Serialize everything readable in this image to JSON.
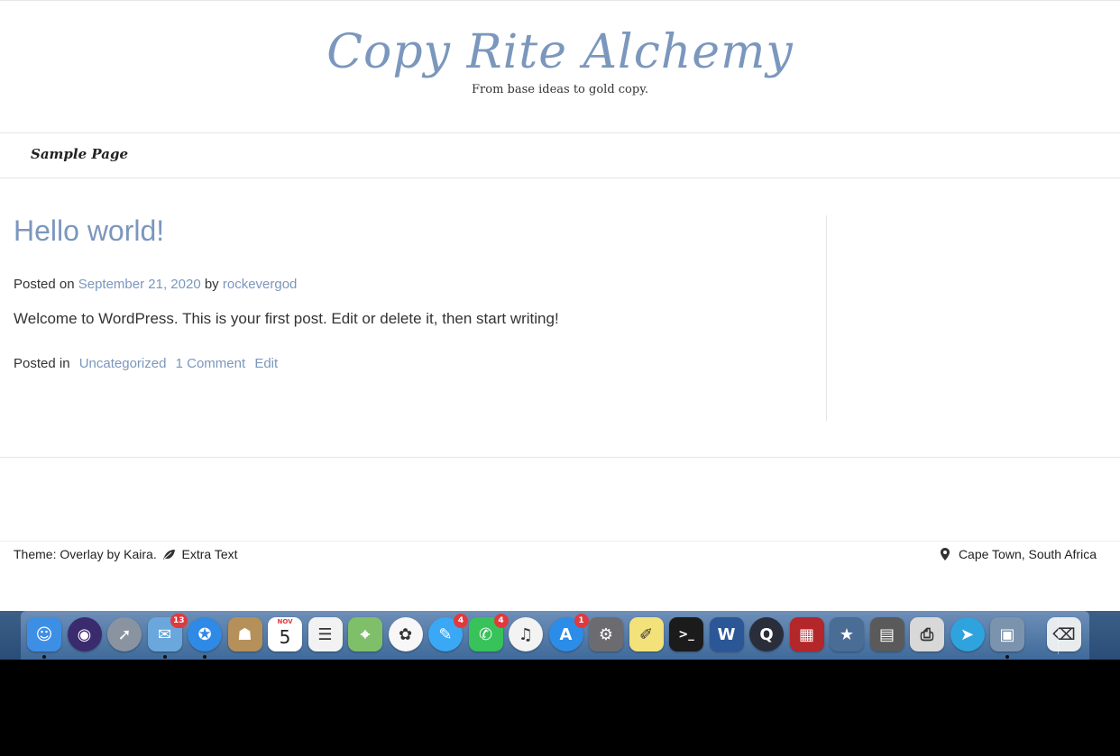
{
  "site": {
    "title": "Copy Rite Alchemy",
    "tagline": "From base ideas to gold copy."
  },
  "nav": {
    "items": [
      {
        "label": "Sample Page"
      }
    ]
  },
  "post": {
    "title": "Hello world!",
    "posted_on_prefix": "Posted on",
    "date": "September 21, 2020",
    "by_text": "by",
    "author": "rockevergod",
    "content": "Welcome to WordPress. This is your first post. Edit or delete it, then start writing!",
    "posted_in_prefix": "Posted in",
    "category": "Uncategorized",
    "comments": "1 Comment",
    "edit": "Edit"
  },
  "footer": {
    "credit": "Theme: Overlay by Kaira.",
    "extra": "Extra Text",
    "location": "Cape Town, South Africa"
  },
  "colors": {
    "accent": "#7b97bd",
    "text": "#333333"
  },
  "dock": {
    "items": [
      {
        "name": "finder-icon",
        "glyph": "☺",
        "color": "#3d8fe6",
        "running": true
      },
      {
        "name": "siri-icon",
        "glyph": "◉",
        "color": "#3a2a6e",
        "round": true
      },
      {
        "name": "launchpad-icon",
        "glyph": "➚",
        "color": "#8a94a0",
        "round": true
      },
      {
        "name": "mail-icon",
        "glyph": "✉",
        "color": "#6aa7dc",
        "badge": "13",
        "running": true
      },
      {
        "name": "safari-icon",
        "glyph": "✪",
        "color": "#2f8ae6",
        "round": true,
        "running": true
      },
      {
        "name": "contacts-icon",
        "glyph": "☗",
        "color": "#b5905a"
      },
      {
        "name": "calendar-icon",
        "calendar": true,
        "month": "NOV",
        "day": "5",
        "color": "#ffffff"
      },
      {
        "name": "reminders-icon",
        "glyph": "☰",
        "color": "#f2f2f2",
        "dark": true
      },
      {
        "name": "maps-icon",
        "glyph": "⌖",
        "color": "#7fbf6a"
      },
      {
        "name": "photos-icon",
        "glyph": "✿",
        "color": "#f7f7f7",
        "dark": true,
        "round": true
      },
      {
        "name": "messages-icon",
        "glyph": "✎",
        "color": "#3aa8f5",
        "round": true,
        "badge": "4"
      },
      {
        "name": "facetime-icon",
        "glyph": "✆",
        "color": "#37c25a",
        "badge": "4"
      },
      {
        "name": "itunes-icon",
        "glyph": "♫",
        "color": "#f3f3f3",
        "dark": true,
        "round": true
      },
      {
        "name": "app-store-icon",
        "glyph": "A",
        "color": "#2c8de8",
        "round": true,
        "badge": "1"
      },
      {
        "name": "system-preferences-icon",
        "glyph": "⚙",
        "color": "#6c6c70"
      },
      {
        "name": "stickies-icon",
        "glyph": "✐",
        "color": "#f3e27a",
        "dark": true
      },
      {
        "name": "terminal-icon",
        "glyph": ">_",
        "color": "#1b1b1b"
      },
      {
        "name": "word-icon",
        "glyph": "W",
        "color": "#2b5797"
      },
      {
        "name": "quicktime-icon",
        "glyph": "Q",
        "color": "#2a2d3a",
        "round": true
      },
      {
        "name": "photo-booth-icon",
        "glyph": "▦",
        "color": "#b3262a"
      },
      {
        "name": "preview-star-icon",
        "glyph": "★",
        "color": "#4a6d96"
      },
      {
        "name": "scanner-icon",
        "glyph": "▤",
        "color": "#5a5a5a"
      },
      {
        "name": "printer-icon",
        "glyph": "⎙",
        "color": "#d8d8d8",
        "dark": true
      },
      {
        "name": "telegram-icon",
        "glyph": "➤",
        "color": "#2fa3dd",
        "round": true
      },
      {
        "name": "preview-icon",
        "glyph": "▣",
        "color": "#7b93ad",
        "running": true
      },
      {
        "name": "trash-icon",
        "glyph": "⌫",
        "color": "#e8ecef",
        "dark": true,
        "trash": true
      }
    ]
  }
}
